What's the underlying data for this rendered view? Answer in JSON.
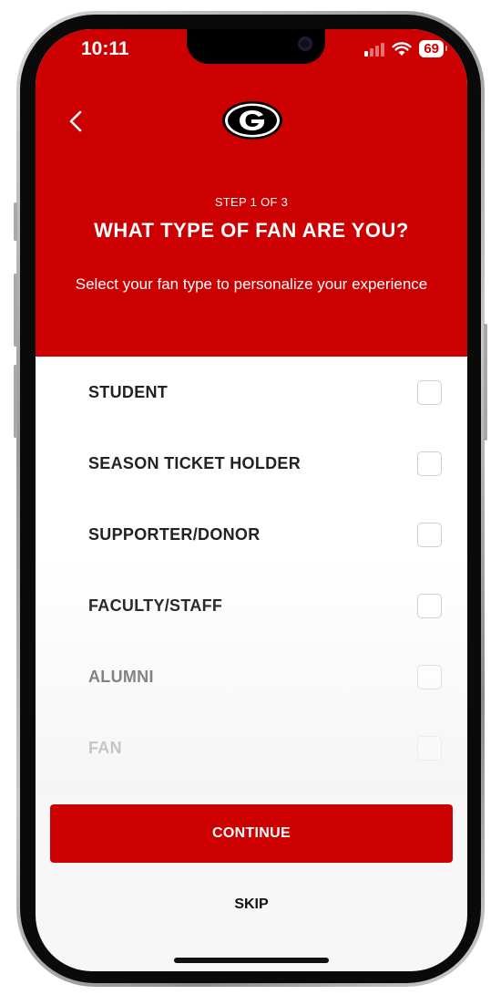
{
  "status_bar": {
    "time": "10:11",
    "battery": "69",
    "icons": [
      "cellular-signal-icon",
      "wifi-icon",
      "battery-icon"
    ]
  },
  "header": {
    "back_icon": "chevron-left-icon",
    "logo": "georgia-g-logo",
    "step": "STEP 1 OF 3",
    "title": "WHAT TYPE OF FAN ARE YOU?",
    "subtitle": "Select your fan type to personalize your experience"
  },
  "options": [
    {
      "label": "STUDENT",
      "checked": false
    },
    {
      "label": "SEASON TICKET HOLDER",
      "checked": false
    },
    {
      "label": "SUPPORTER/DONOR",
      "checked": false
    },
    {
      "label": "FACULTY/STAFF",
      "checked": false
    },
    {
      "label": "ALUMNI",
      "checked": false
    },
    {
      "label": "FAN",
      "checked": false
    }
  ],
  "actions": {
    "continue_label": "CONTINUE",
    "skip_label": "SKIP"
  },
  "colors": {
    "brand_red": "#cc0000",
    "text_dark": "#222222"
  }
}
